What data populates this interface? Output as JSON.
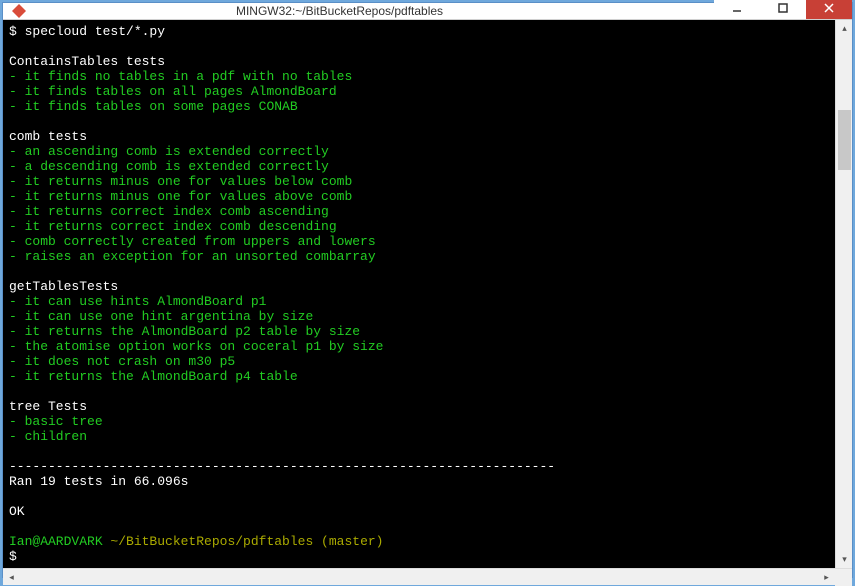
{
  "window": {
    "title": "MINGW32:~/BitBucketRepos/pdftables"
  },
  "prompt_symbol": "$",
  "command": " specloud test/*.py",
  "blank": "",
  "groups": [
    {
      "header": "ContainsTables tests",
      "lines": [
        "- it finds no tables in a pdf with no tables",
        "- it finds tables on all pages AlmondBoard",
        "- it finds tables on some pages CONAB"
      ]
    },
    {
      "header": "comb tests",
      "lines": [
        "- an ascending comb is extended correctly",
        "- a descending comb is extended correctly",
        "- it returns minus one for values below comb",
        "- it returns minus one for values above comb",
        "- it returns correct index comb ascending",
        "- it returns correct index comb descending",
        "- comb correctly created from uppers and lowers",
        "- raises an exception for an unsorted combarray"
      ]
    },
    {
      "header": "getTablesTests",
      "lines": [
        "- it can use hints AlmondBoard p1",
        "- it can use one hint argentina by size",
        "- it returns the AlmondBoard p2 table by size",
        "- the atomise option works on coceral p1 by size",
        "- it does not crash on m30 p5",
        "- it returns the AlmondBoard p4 table"
      ]
    },
    {
      "header": "tree Tests",
      "lines": [
        "- basic tree",
        "- children"
      ]
    }
  ],
  "divider": "----------------------------------------------------------------------",
  "result_line": "Ran 19 tests in 66.096s",
  "ok_line": "OK",
  "prompt2_user": "Ian@AARDVARK ",
  "prompt2_path": "~/BitBucketRepos/pdftables (master)",
  "prompt3": "$"
}
